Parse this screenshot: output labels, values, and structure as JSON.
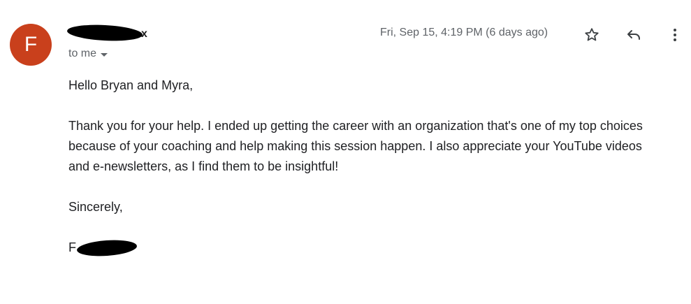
{
  "sender": {
    "avatar_letter": "F",
    "name_visible_tail": "x",
    "recipient_label": "to me"
  },
  "header": {
    "date": "Fri, Sep 15, 4:19 PM (6 days ago)"
  },
  "message": {
    "greeting": "Hello Bryan and Myra,",
    "paragraph": "Thank you for your help. I ended up getting the career with an organization that's one of my top choices because of your coaching and help making this session happen. I also appreciate your YouTube videos and e-newsletters, as I find them to be insightful!",
    "closing": "Sincerely,",
    "signature_initial": "F"
  },
  "icons": {
    "star": "star-icon",
    "reply": "reply-icon",
    "more": "more-vert-icon"
  },
  "colors": {
    "avatar_bg": "#c9401c",
    "meta_text": "#5f6368",
    "body_text": "#202124"
  }
}
